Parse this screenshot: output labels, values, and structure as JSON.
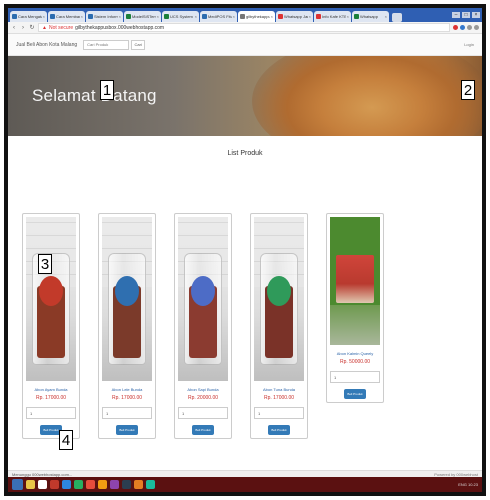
{
  "browser": {
    "tabs": [
      {
        "label": "Cara Mengatasi Data",
        "color": "#2b6cb0"
      },
      {
        "label": "Cara Membangun Rules",
        "color": "#2b6cb0"
      },
      {
        "label": "Sistem Informasi Ma",
        "color": "#2b6cb0"
      },
      {
        "label": "ModelSiSTem-Informasi",
        "color": "#1b7f3a"
      },
      {
        "label": "UCS System",
        "color": "#1b7f3a"
      },
      {
        "label": "MediPOS Fitur Cell",
        "color": "#2b6cb0"
      },
      {
        "label": "gilbythekappusbox",
        "color": "#777777",
        "active": true
      },
      {
        "label": "Whatsapp Jaringan",
        "color": "#d33"
      },
      {
        "label": "Info Kafe KTBfin",
        "color": "#d33"
      },
      {
        "label": "Whatsapp",
        "color": "#1b7f3a"
      }
    ],
    "security_label": "Not secure",
    "url": "gilbythekappusbox.000webhostapp.com"
  },
  "navbar": {
    "brand": "Jual Beli Abon Kota Malang",
    "search_placeholder": "Cari Produk",
    "search_button": "Cari",
    "login": "Login"
  },
  "hero": {
    "title": "Selamat Datang"
  },
  "section_title": "List Produk",
  "products": [
    {
      "name": "Abon Ayam Bunda",
      "price": "Rp. 17000.00",
      "qty": "1",
      "button": "Beli Produk",
      "fill": "#8a3a26",
      "label": "#c23a2a"
    },
    {
      "name": "Abon Lele Bunda",
      "price": "Rp. 17000.00",
      "qty": "1",
      "button": "Beli Produk",
      "fill": "#7b3a2a",
      "label": "#2f6fb0"
    },
    {
      "name": "Abon Sapi Bunda",
      "price": "Rp. 20000.00",
      "qty": "1",
      "button": "Beli Produk",
      "fill": "#8b3b30",
      "label": "#4d6cc6"
    },
    {
      "name": "Abon Tuna Bunda",
      "price": "Rp. 17000.00",
      "qty": "1",
      "button": "Beli Produk",
      "fill": "#7a3228",
      "label": "#2f9a5a"
    },
    {
      "name": "Abon Kalmin Queely",
      "price": "Rp. 50000.00",
      "qty": "1",
      "button": "Beli Produk"
    }
  ],
  "status": {
    "left": "Menunggu 000webhostapp.com...",
    "right": "Powered by 000webhost"
  },
  "taskbar": {
    "icon_colors": [
      "#e8c547",
      "#ffffff",
      "#c0392b",
      "#2e86de",
      "#27ae60",
      "#e74c3c",
      "#f39c12",
      "#8e44ad",
      "#2c3e50",
      "#e67e22",
      "#1abc9c"
    ],
    "tray": "ENG 10.23"
  },
  "callouts": [
    "1",
    "2",
    "3",
    "4"
  ]
}
